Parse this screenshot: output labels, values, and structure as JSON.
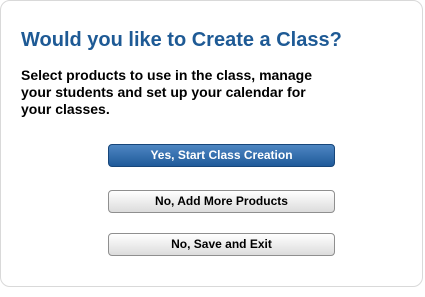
{
  "dialog": {
    "title": "Would you like to Create a Class?",
    "description": "Select products to use in the class, manage your students and set up your calendar for your classes.",
    "buttons": {
      "start_label": "Yes, Start Class Creation",
      "add_products_label": "No, Add More Products",
      "save_exit_label": "No, Save and Exit"
    },
    "colors": {
      "title": "#1e5a95",
      "primary_button": "#1f5a9a"
    }
  }
}
